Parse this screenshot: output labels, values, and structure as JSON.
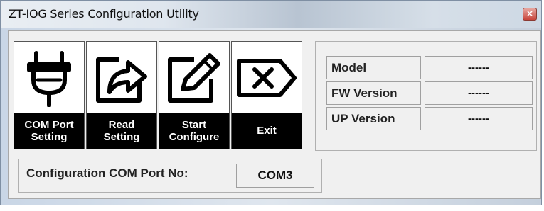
{
  "window": {
    "title": "ZT-IOG Series Configuration Utility",
    "close_glyph": "×"
  },
  "toolbar": {
    "buttons": [
      {
        "label": "COM Port\nSetting",
        "icon": "power-plug-icon"
      },
      {
        "label": "Read\nSetting",
        "icon": "share-arrow-icon"
      },
      {
        "label": "Start\nConfigure",
        "icon": "edit-pencil-icon"
      },
      {
        "label": "Exit",
        "icon": "exit-tag-icon"
      }
    ]
  },
  "device_info": {
    "model_label": "Model",
    "model_value": "------",
    "fw_label": "FW Version",
    "fw_value": "------",
    "up_label": "UP Version",
    "up_value": "------"
  },
  "com_port": {
    "label": "Configuration COM Port No:",
    "value": "COM3"
  }
}
